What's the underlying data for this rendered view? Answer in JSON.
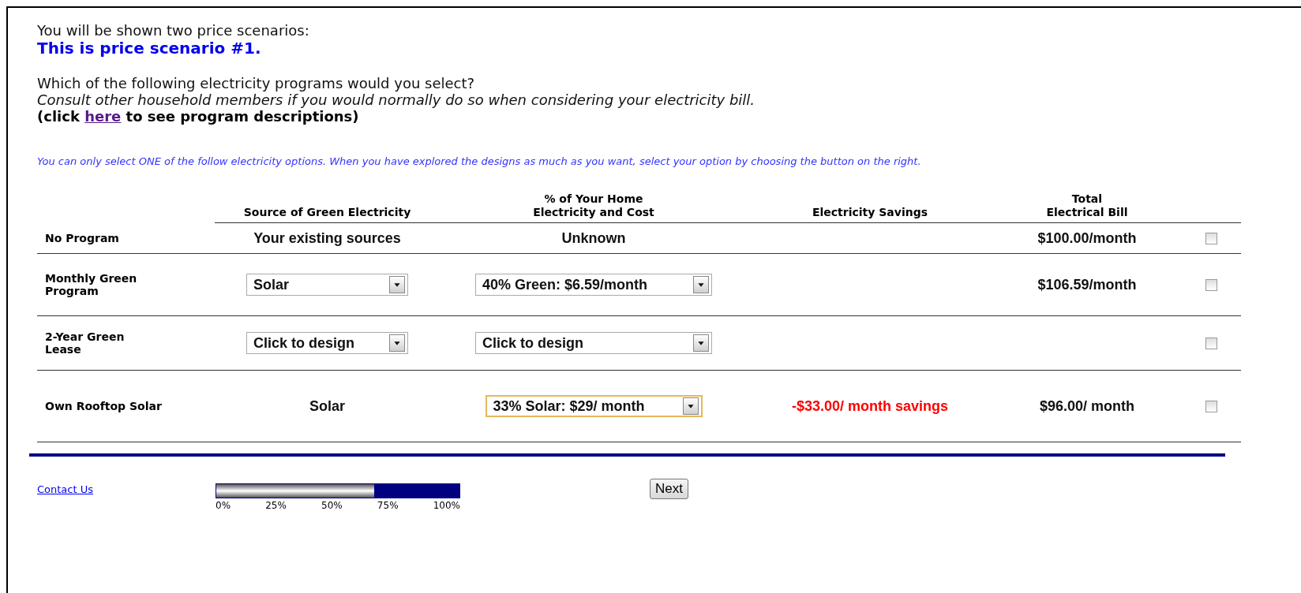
{
  "intro": "You will be shown two price scenarios:",
  "scenario_title": "This is price scenario #1.",
  "question": "Which of the following electricity programs would you select?",
  "hint": "Consult other household members if you would normally do so when considering your electricity bill.",
  "descriptions_prefix": "(click",
  "descriptions_link": "here",
  "descriptions_suffix": "to see program descriptions)",
  "instruction": "You can only select ONE of the follow electricity options. When you have explored the designs as much as you want, select your option by choosing the button on the right.",
  "table": {
    "columns": [
      "",
      "Source of Green Electricity",
      "% of Your Home\nElectricity and Cost",
      "Electricity Savings",
      "Total\nElectrical Bill"
    ],
    "rows": [
      {
        "label": "No Program",
        "source": {
          "kind": "text",
          "value": "Your existing sources"
        },
        "share": {
          "kind": "text",
          "value": "Unknown"
        },
        "bill": "$100.00/month",
        "checked": false
      },
      {
        "label": "Monthly Green Program",
        "source": {
          "kind": "select",
          "value": "Solar",
          "focused": false
        },
        "share": {
          "kind": "select",
          "value": "40% Green: $6.59/month",
          "focused": false
        },
        "bill": "$106.59/month",
        "checked": false
      },
      {
        "label": "2-Year Green Lease",
        "source": {
          "kind": "select",
          "value": "Click to design",
          "focused": false
        },
        "share": {
          "kind": "select",
          "value": "Click to design",
          "focused": false
        },
        "checked": false
      },
      {
        "label": "Own Rooftop Solar",
        "source": {
          "kind": "text",
          "value": "Solar"
        },
        "share": {
          "kind": "select",
          "value": "33% Solar: $29/ month",
          "focused": true
        },
        "savings": "-$33.00/ month savings",
        "bill": "$96.00/ month",
        "checked": false
      }
    ]
  },
  "footer": {
    "contact": "Contact Us",
    "progress": {
      "level": 0.65,
      "ticks": [
        "0%",
        "25%",
        "50%",
        "75%",
        "100%"
      ]
    },
    "next": "Next"
  }
}
